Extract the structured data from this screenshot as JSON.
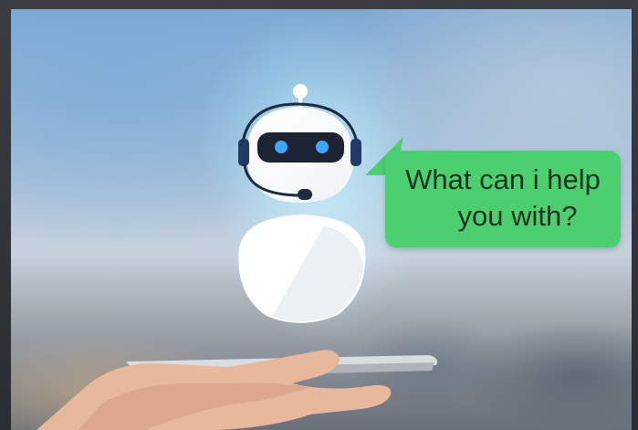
{
  "image": {
    "scene": "robot-chatbot-over-phone",
    "chat_bubble": {
      "line1": "What can i help",
      "line2": "you with?",
      "color": "#4ccf6f"
    },
    "robot": {
      "body_color": "#ffffff",
      "visor_color": "#1c2433",
      "eye_color": "#3aa8ff",
      "headset_color": "#233a66"
    }
  }
}
